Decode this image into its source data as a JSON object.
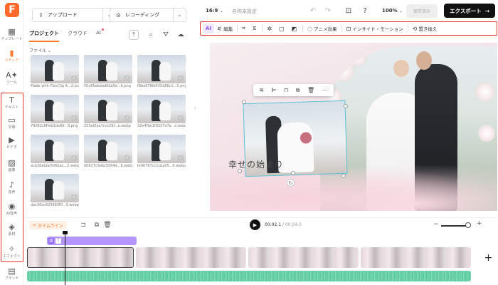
{
  "rail": {
    "logo": "F",
    "items": [
      {
        "icon": "template-icon",
        "glyph": "▦",
        "label": "テンプレート",
        "active": false
      },
      {
        "icon": "media-icon",
        "glyph": "▮",
        "label": "メディア",
        "active": true
      },
      {
        "icon": "ai-tools-icon",
        "glyph": "A✦",
        "label": "ツール",
        "active": false
      },
      {
        "icon": "text-icon",
        "glyph": "T",
        "label": "テキスト",
        "active": false
      },
      {
        "icon": "caption-icon",
        "glyph": "▭",
        "label": "字幕",
        "active": false
      },
      {
        "icon": "video-icon",
        "glyph": "▶",
        "label": "ビデオ",
        "active": false
      },
      {
        "icon": "image-icon",
        "glyph": "▨",
        "label": "画像",
        "active": false
      },
      {
        "icon": "music-icon",
        "glyph": "♪",
        "label": "音声",
        "active": false
      },
      {
        "icon": "ai-voice-icon",
        "glyph": "◉",
        "label": "AI音声",
        "active": false
      },
      {
        "icon": "elements-icon",
        "glyph": "◈",
        "label": "素材",
        "active": false
      },
      {
        "icon": "effects-icon",
        "glyph": "✧",
        "label": "エフェクト",
        "active": false
      },
      {
        "icon": "brand-icon",
        "glyph": "▤",
        "label": "ブランド",
        "active": false
      }
    ]
  },
  "panel": {
    "upload_label": "アップロード",
    "record_label": "レコーディング",
    "tabs": [
      {
        "label": "プロジェクト",
        "active": true
      },
      {
        "label": "クラウド",
        "active": false
      },
      {
        "label": "AI",
        "active": false
      }
    ],
    "filter_label": "ファイル ⌄",
    "files": [
      {
        "name": "Made with FlexClip A...2.png"
      },
      {
        "name": "50c65ebebd0da5e...b.png"
      },
      {
        "name": "f9ba978fb425d66c1...0.png"
      },
      {
        "name": "79082c6ffeb3da99...8.png"
      },
      {
        "name": "255ef2ea7ccc29f...e.webp"
      },
      {
        "name": "32e4f9e1f0327a7a...e.webp"
      },
      {
        "name": "acb26ebbe506bac...2.webp"
      },
      {
        "name": "d0617c9a6c5564d...8.webp"
      },
      {
        "name": "fe96787cc1cba05...6.webp"
      },
      {
        "name": "dac36cc623983f0...5.webp"
      }
    ]
  },
  "header": {
    "ratio": "16:9",
    "title": "名称未設定",
    "zoom": "100%",
    "save_label": "保存済み",
    "export_label": "エクスポート"
  },
  "edit_toolbar": {
    "items": [
      {
        "icon": "ai-edit-icon",
        "glyph": "AI",
        "label": ""
      },
      {
        "icon": "adjust-icon",
        "glyph": "⚟",
        "label": "編集"
      },
      {
        "icon": "crop-icon",
        "glyph": "⌗",
        "label": ""
      },
      {
        "icon": "flip-icon",
        "glyph": "⧖",
        "label": ""
      },
      {
        "icon": "filter-icon",
        "glyph": "✲",
        "label": ""
      },
      {
        "icon": "border-icon",
        "glyph": "▢",
        "label": ""
      },
      {
        "icon": "mask-icon",
        "glyph": "◩",
        "label": ""
      },
      {
        "icon": "animation-icon",
        "glyph": "◌",
        "label": "アニメ効果"
      },
      {
        "icon": "inside-motion-icon",
        "glyph": "⊡",
        "label": "インサイド・モーション"
      },
      {
        "icon": "replace-icon",
        "glyph": "⟲",
        "label": "置き換え"
      }
    ]
  },
  "canvas": {
    "caption": "幸せの始まり"
  },
  "timeline": {
    "label": "タイムライン",
    "current_time": "00:02.1",
    "total_time": "/ 00:24.0"
  },
  "colors": {
    "accent": "#ff7a2c",
    "highlight_box": "#e5322d",
    "ai_purple": "#8a53ff",
    "text_track": "#b596ff",
    "audio_track": "#51c798"
  }
}
